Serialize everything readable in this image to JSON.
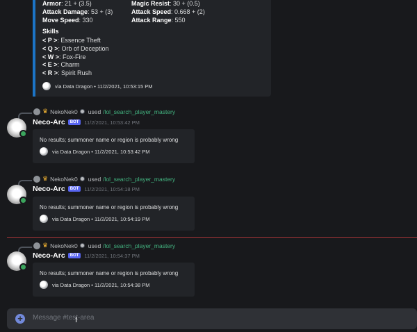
{
  "colors": {
    "background": "#18191c",
    "embed_accent": "#1c74c6",
    "command": "#43b581",
    "online": "#3ba55d",
    "bot_tag": "#5865f2",
    "mention_divider": "#ed4245"
  },
  "top_embed": {
    "stats": [
      {
        "label": "Armor",
        "value": ": 21 + (3.5)"
      },
      {
        "label": "Magic Resist",
        "value": ": 30 + (0.5)"
      },
      {
        "label": "Attack Damage",
        "value": ": 53 + (3)"
      },
      {
        "label": "Attack Speed",
        "value": ": 0.668 + (2)"
      },
      {
        "label": "Move Speed",
        "value": ": 330"
      },
      {
        "label": "Attack Range",
        "value": ": 550"
      }
    ],
    "skills_title": "Skills",
    "skills": [
      {
        "key": "< P >",
        "name": ": Essence Theft"
      },
      {
        "key": "< Q >",
        "name": ": Orb of Deception"
      },
      {
        "key": "< W >",
        "name": ": Fox-Fire"
      },
      {
        "key": "< E >",
        "name": ": Charm"
      },
      {
        "key": "< R >",
        "name": ": Spirit Rush"
      }
    ],
    "footer": "via Data Dragon • 11/2/2021, 10:53:15 PM"
  },
  "messages": [
    {
      "reply_user": "NekoNek0",
      "reply_used": "used",
      "reply_command": "/lol_search_player_mastery",
      "author": "Neco-Arc",
      "bot_tag": "BOT",
      "timestamp": "11/2/2021, 10:53:42 PM",
      "description": "No results; summoner name or region is probably wrong",
      "footer": "via Data Dragon • 11/2/2021, 10:53:42 PM"
    },
    {
      "reply_user": "NekoNek0",
      "reply_used": "used",
      "reply_command": "/lol_search_player_mastery",
      "author": "Neco-Arc",
      "bot_tag": "BOT",
      "timestamp": "11/2/2021, 10:54:18 PM",
      "description": "No results; summoner name or region is probably wrong",
      "footer": "via Data Dragon • 11/2/2021, 10:54:19 PM"
    },
    {
      "reply_user": "NekoNek0",
      "reply_used": "used",
      "reply_command": "/lol_search_player_mastery",
      "author": "Neco-Arc",
      "bot_tag": "BOT",
      "timestamp": "11/2/2021, 10:54:37 PM",
      "description": "No results; summoner name or region is probably wrong",
      "footer": "via Data Dragon • 11/2/2021, 10:54:38 PM"
    }
  ],
  "input": {
    "placeholder": "Message #test-area",
    "plus_icon": "+"
  }
}
